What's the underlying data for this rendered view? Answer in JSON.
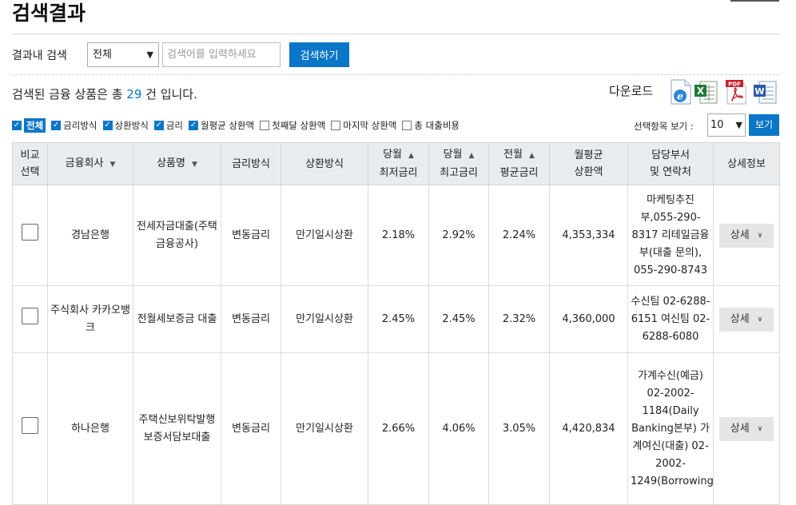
{
  "page_title": "검색결과",
  "search": {
    "label": "결과내 검색",
    "scope": "전체",
    "placeholder": "검색어를 입력하세요",
    "button": "검색하기"
  },
  "summary": {
    "prefix": "검색된 금융 상품은 총 ",
    "count": "29",
    "suffix": " 건 입니다."
  },
  "download": {
    "label": "다운로드",
    "icons": [
      "ie-icon",
      "excel-icon",
      "pdf-icon",
      "word-icon"
    ]
  },
  "options": [
    {
      "label": "전체",
      "checked": true
    },
    {
      "label": "금리방식",
      "checked": true
    },
    {
      "label": "상환방식",
      "checked": true
    },
    {
      "label": "금리",
      "checked": true
    },
    {
      "label": "월평균 상환액",
      "checked": true
    },
    {
      "label": "첫째달 상환액",
      "checked": false
    },
    {
      "label": "마지막 상환액",
      "checked": false
    },
    {
      "label": "총 대출비용",
      "checked": false
    }
  ],
  "view": {
    "label": "선택항목 보기 :",
    "value": "10",
    "button": "보기"
  },
  "table": {
    "headers": {
      "compare_1": "비교",
      "compare_2": "선택",
      "company": "금융회사",
      "product": "상품명",
      "rate_type": "금리방식",
      "repay": "상환방식",
      "min_1": "당월",
      "min_2": "최저금리",
      "max_1": "당월",
      "max_2": "최고금리",
      "avg_1": "전월",
      "avg_2": "평균금리",
      "monthly_1": "월평균",
      "monthly_2": "상환액",
      "contact_1": "담당부서",
      "contact_2": "및 연락처",
      "detail": "상세정보"
    },
    "rows": [
      {
        "company": "경남은행",
        "product": "전세자금대출(주택금융공사)",
        "rate_type": "변동금리",
        "repay": "만기일시상환",
        "min": "2.18%",
        "max": "2.92%",
        "avg": "2.24%",
        "monthly": "4,353,334",
        "contact": "마케팅추진부,055-290-8317 리테일금융부(대출 문의), 055-290-8743",
        "detail": "상세"
      },
      {
        "company": "주식회사 카카오뱅크",
        "product": "전월세보증금 대출",
        "rate_type": "변동금리",
        "repay": "만기일시상환",
        "min": "2.45%",
        "max": "2.45%",
        "avg": "2.32%",
        "monthly": "4,360,000",
        "contact": "수신팀 02-6288-6151 여신팀 02-6288-6080",
        "detail": "상세"
      },
      {
        "company": "하나은행",
        "product": "주택신보위탁발행보증서담보대출",
        "rate_type": "변동금리",
        "repay": "만기일시상환",
        "min": "2.66%",
        "max": "4.06%",
        "avg": "3.05%",
        "monthly": "4,420,834",
        "contact": "가계수신(예금) 02-2002-1184(Daily Banking본부) 가계여신(대출) 02-2002-1249(Borrowing",
        "detail": "상세"
      }
    ]
  }
}
